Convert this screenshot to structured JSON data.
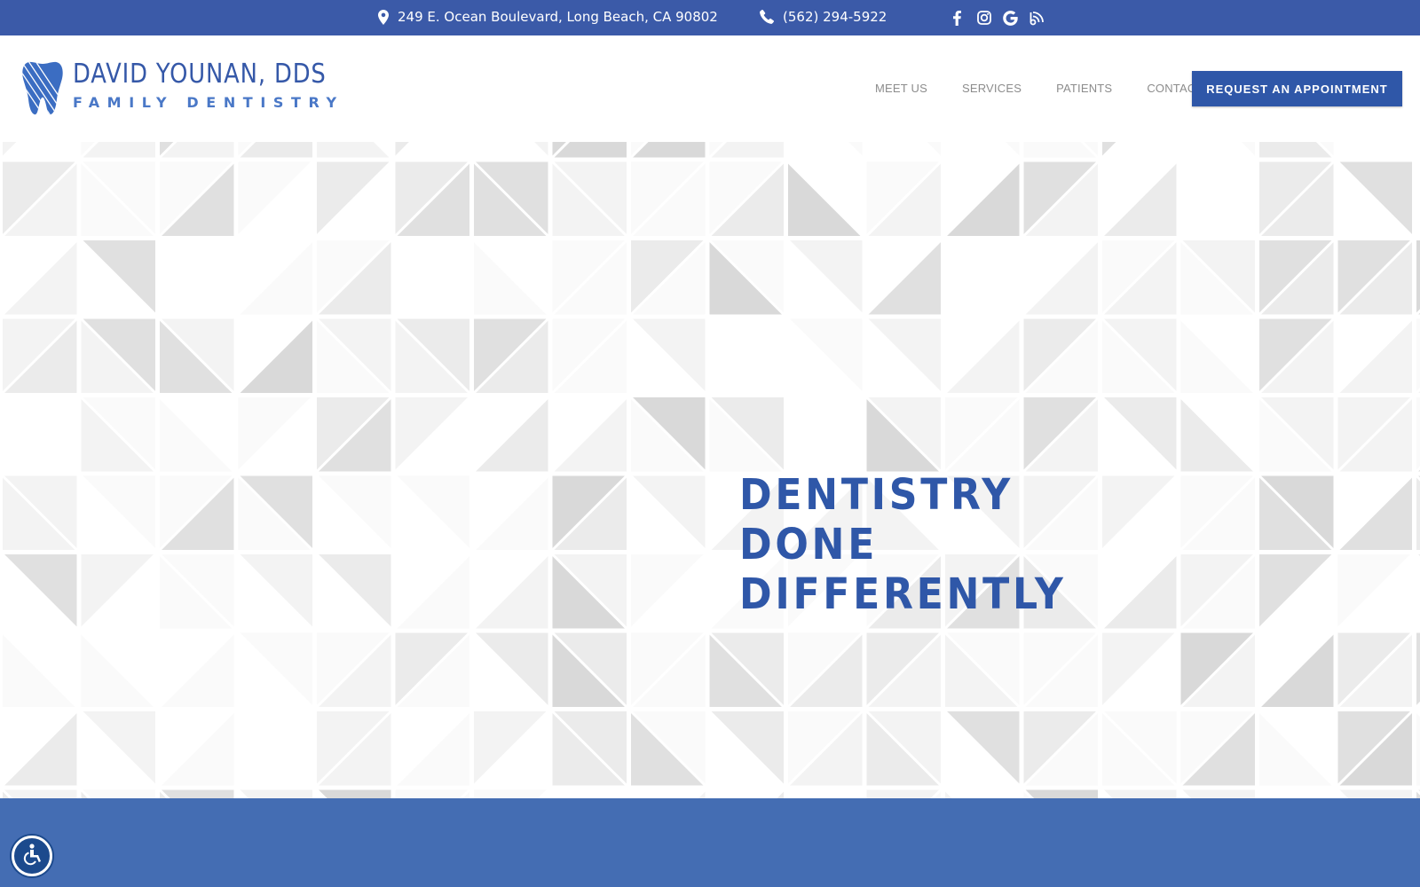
{
  "topbar": {
    "address": "249 E. Ocean Boulevard, Long Beach, CA 90802",
    "phone": "(562) 294-5922",
    "socials": [
      "facebook-icon",
      "instagram-icon",
      "google-icon",
      "blog-icon"
    ]
  },
  "logo": {
    "name": "DAVID YOUNAN, DDS",
    "subtitle": "FAMILY DENTISTRY"
  },
  "nav": {
    "items": [
      {
        "label": "MEET US"
      },
      {
        "label": "SERVICES"
      },
      {
        "label": "PATIENTS"
      },
      {
        "label": "CONTACT"
      }
    ],
    "cta_label": "REQUEST AN APPOINTMENT"
  },
  "hero": {
    "headline": [
      "DENTISTRY",
      "DONE",
      "DIFFERENTLY"
    ]
  },
  "colors": {
    "brand_blue": "#2f57a8",
    "topbar_blue": "#3b5aa8",
    "band_blue": "#446db3",
    "logo_subtitle_blue": "#4a78c7"
  }
}
